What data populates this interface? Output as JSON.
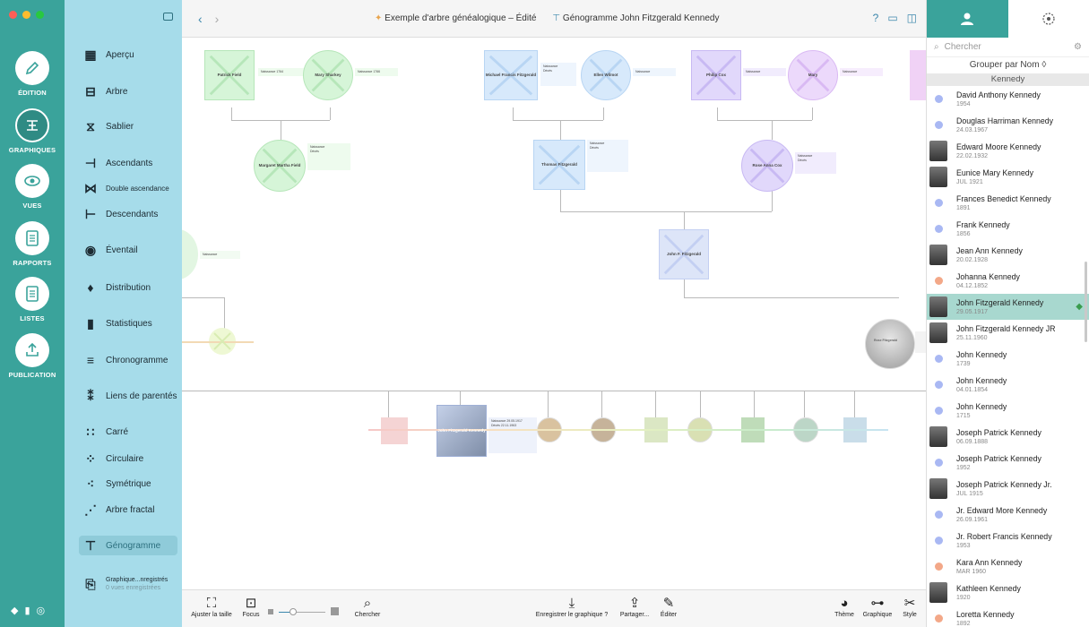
{
  "window": {
    "title": "Exemple d'arbre généalogique – Édité",
    "chart_title": "Génogramme John Fitzgerald Kennedy",
    "traffic_colors": [
      "#ff5f57",
      "#febc2e",
      "#28c840"
    ]
  },
  "rail": {
    "items": [
      {
        "label": "ÉDITION",
        "icon": "pencil-icon"
      },
      {
        "label": "GRAPHIQUES",
        "icon": "charts-icon"
      },
      {
        "label": "VUES",
        "icon": "eye-icon"
      },
      {
        "label": "RAPPORTS",
        "icon": "report-icon"
      },
      {
        "label": "LISTES",
        "icon": "list-icon"
      },
      {
        "label": "PUBLICATION",
        "icon": "upload-icon"
      }
    ]
  },
  "menu": {
    "items": [
      {
        "label": "Aperçu",
        "glyph": "▦"
      },
      {
        "label": "Arbre",
        "glyph": "⊟"
      },
      {
        "label": "Sablier",
        "glyph": "⧖"
      },
      {
        "label": "Ascendants",
        "glyph": "⊣"
      },
      {
        "label": "Double ascendance",
        "glyph": "⋈"
      },
      {
        "label": "Descendants",
        "glyph": "⊢"
      },
      {
        "label": "Éventail",
        "glyph": "◉"
      },
      {
        "label": "Distribution",
        "glyph": "♦"
      },
      {
        "label": "Statistiques",
        "glyph": "▮"
      },
      {
        "label": "Chronogramme",
        "glyph": "≡"
      },
      {
        "label": "Liens de parentés",
        "glyph": "⁑"
      },
      {
        "label": "Carré",
        "glyph": "∷"
      },
      {
        "label": "Circulaire",
        "glyph": "⁘"
      },
      {
        "label": "Symétrique",
        "glyph": "⁖"
      },
      {
        "label": "Arbre fractal",
        "glyph": "⋰"
      },
      {
        "label": "Génogramme",
        "glyph": "⊤"
      }
    ],
    "saved_title": "Graphique...nregistrés",
    "saved_sub": "0 vues enregistrées"
  },
  "canvas": {
    "people": [
      {
        "name": "Patrick Field",
        "shape": "square",
        "color": "#d6f5d8"
      },
      {
        "name": "Mary Sharkey",
        "shape": "circle",
        "color": "#d6f5d8"
      },
      {
        "name": "Michael Francis Fitzgerald",
        "shape": "square",
        "color": "#d7e9fb"
      },
      {
        "name": "Ellen Wilmot",
        "shape": "circle",
        "color": "#d7e9fb"
      },
      {
        "name": "Philip Cox",
        "shape": "square",
        "color": "#e1d8fb"
      },
      {
        "name": "Mary",
        "shape": "circle",
        "color": "#ecd9fb"
      },
      {
        "name": "Margaret Martha Field",
        "shape": "circle",
        "color": "#d6f5d8"
      },
      {
        "name": "Thomas Fitzgerald",
        "shape": "square",
        "color": "#d7e9fb"
      },
      {
        "name": "Rose Anna Cox",
        "shape": "circle",
        "color": "#e1d8fb"
      },
      {
        "name": "John F. Fitzgerald",
        "shape": "square",
        "color": "#dde5f8"
      },
      {
        "name": "Rose Fitzgerald",
        "shape": "circle",
        "color": "#eeeeee"
      },
      {
        "name": "John Fitzgerald Kennedy",
        "shape": "square",
        "color": "#dde5f8"
      }
    ],
    "info_birth": "Naissance",
    "info_death": "Décès"
  },
  "toolbar": {
    "left": [
      {
        "label": "Ajuster la taille",
        "icon": "fit-icon",
        "glyph": "⛶"
      },
      {
        "label": "Focus",
        "icon": "focus-icon",
        "glyph": "⊡"
      },
      {
        "label": "Chercher",
        "icon": "search-icon",
        "glyph": "⌕"
      }
    ],
    "center": [
      {
        "label": "Enregistrer le graphique ?",
        "icon": "download-icon",
        "glyph": "⤓"
      },
      {
        "label": "Partager...",
        "icon": "share-icon",
        "glyph": "⇪"
      },
      {
        "label": "Éditer",
        "icon": "edit-icon",
        "glyph": "✎"
      }
    ],
    "right": [
      {
        "label": "Thème",
        "icon": "palette-icon",
        "glyph": "◕"
      },
      {
        "label": "Graphique",
        "icon": "toggle-icon",
        "glyph": "⊶"
      },
      {
        "label": "Style",
        "icon": "scissors-icon",
        "glyph": "✂"
      }
    ]
  },
  "sidebar": {
    "search_placeholder": "Chercher",
    "group_by": "Grouper par Nom ◊",
    "group_name": "Kennedy",
    "persons": [
      {
        "name": "David Anthony Kennedy",
        "date": "1954",
        "photo": false,
        "color": "#a9b8f3"
      },
      {
        "name": "Douglas Harriman Kennedy",
        "date": "24.03.1967",
        "photo": false,
        "color": "#a9b8f3"
      },
      {
        "name": "Edward Moore Kennedy",
        "date": "22.02.1932",
        "photo": true,
        "color": "#a9b8f3"
      },
      {
        "name": "Eunice Mary Kennedy",
        "date": "JUL 1921",
        "photo": true,
        "color": "#f3a888"
      },
      {
        "name": "Frances Benedict Kennedy",
        "date": "1891",
        "photo": false,
        "color": "#a9b8f3"
      },
      {
        "name": "Frank Kennedy",
        "date": "1856",
        "photo": false,
        "color": "#a9b8f3"
      },
      {
        "name": "Jean Ann Kennedy",
        "date": "20.02.1928",
        "photo": true,
        "color": "#f3a888"
      },
      {
        "name": "Johanna Kennedy",
        "date": "04.12.1852",
        "photo": false,
        "color": "#f3a888"
      },
      {
        "name": "John Fitzgerald Kennedy",
        "date": "29.05.1917",
        "photo": true,
        "color": "#a9b8f3",
        "selected": true
      },
      {
        "name": "John Fitzgerald Kennedy JR",
        "date": "25.11.1960",
        "photo": true,
        "color": "#a9b8f3"
      },
      {
        "name": "John Kennedy",
        "date": "1739",
        "photo": false,
        "color": "#a9b8f3"
      },
      {
        "name": "John Kennedy",
        "date": "04.01.1854",
        "photo": false,
        "color": "#a9b8f3"
      },
      {
        "name": "John Kennedy",
        "date": "1715",
        "photo": false,
        "color": "#a9b8f3"
      },
      {
        "name": "Joseph Patrick Kennedy",
        "date": "06.09.1888",
        "photo": true,
        "color": "#a9b8f3"
      },
      {
        "name": "Joseph Patrick Kennedy",
        "date": "1952",
        "photo": false,
        "color": "#a9b8f3"
      },
      {
        "name": "Joseph Patrick Kennedy Jr.",
        "date": "JUL 1915",
        "photo": true,
        "color": "#a9b8f3"
      },
      {
        "name": "Jr. Edward More Kennedy",
        "date": "26.09.1961",
        "photo": false,
        "color": "#a9b8f3"
      },
      {
        "name": "Jr. Robert Francis Kennedy",
        "date": "1953",
        "photo": false,
        "color": "#a9b8f3"
      },
      {
        "name": "Kara Ann Kennedy",
        "date": "MAR 1960",
        "photo": false,
        "color": "#f3a888"
      },
      {
        "name": "Kathleen Kennedy",
        "date": "1920",
        "photo": true,
        "color": "#f3a888"
      },
      {
        "name": "Loretta Kennedy",
        "date": "1892",
        "photo": false,
        "color": "#f3a888"
      }
    ]
  }
}
